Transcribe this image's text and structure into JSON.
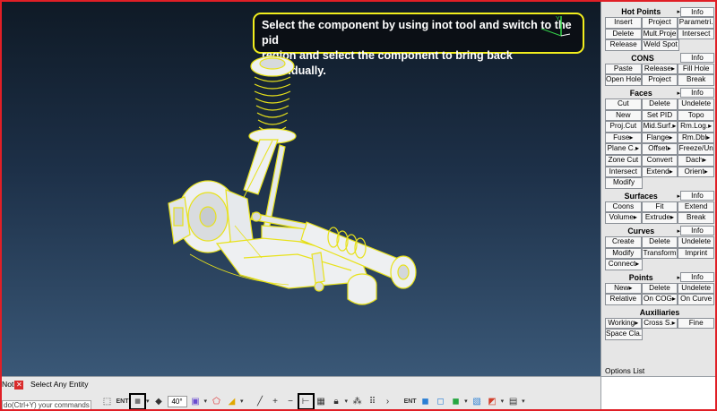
{
  "callout": {
    "line1": "Select the component by using inot tool and switch to the pid",
    "line2": "region and select the component to bring back individually."
  },
  "axis": {
    "y_label": "Y"
  },
  "panel": {
    "sections": [
      {
        "title": "Hot Points",
        "title_arrow": true,
        "info": "Info",
        "rows": [
          [
            "Insert",
            "Project",
            "Parametri."
          ],
          [
            "Delete",
            "Mult.Proje",
            "Intersect"
          ],
          [
            "Release",
            "Weld Spot",
            ""
          ]
        ]
      },
      {
        "title": "CONS",
        "title_arrow": false,
        "info": "Info",
        "rows": [
          [
            "Paste",
            "Release▸",
            "Fill Hole"
          ],
          [
            "Open Hole",
            "Project",
            "Break"
          ]
        ]
      },
      {
        "title": "Faces",
        "title_arrow": true,
        "info": "Info",
        "rows": [
          [
            "Cut",
            "Delete",
            "Undelete"
          ],
          [
            "New",
            "Set PID",
            "Topo"
          ],
          [
            "Proj.Cut",
            "Mid.Surf.▸",
            "Rm.Log.▸"
          ],
          [
            "Fuse▸",
            "Flange▸",
            "Rm.Dbl▸"
          ],
          [
            "Plane C.▸",
            "Offset▸",
            "Freeze/Un"
          ],
          [
            "Zone Cut",
            "Convert",
            "Dach▸"
          ],
          [
            "Intersect",
            "Extend▸",
            "Orient▸"
          ],
          [
            "Modify",
            "",
            ""
          ]
        ]
      },
      {
        "title": "Surfaces",
        "title_arrow": true,
        "info": "Info",
        "rows": [
          [
            "Coons",
            "Fit",
            "Extend"
          ],
          [
            "Volume▸",
            "Extrude▸",
            "Break"
          ]
        ]
      },
      {
        "title": "Curves",
        "title_arrow": true,
        "info": "Info",
        "rows": [
          [
            "Create",
            "Delete",
            "Undelete"
          ],
          [
            "Modify",
            "Transform",
            "Imprint"
          ],
          [
            "Connect▸",
            "",
            ""
          ]
        ]
      },
      {
        "title": "Points",
        "title_arrow": true,
        "info": "Info",
        "rows": [
          [
            "New▸",
            "Delete",
            "Undelete"
          ],
          [
            "Relative",
            "On COG▸",
            "On Curve"
          ]
        ]
      },
      {
        "title": "Auxiliaries",
        "title_arrow": false,
        "info": "",
        "rows": [
          [
            "Working▸",
            "Cross S.▸",
            "Fine"
          ],
          [
            "Space Cla.",
            "",
            ""
          ]
        ]
      }
    ]
  },
  "options": {
    "title": "Options List"
  },
  "status": {
    "not_label": "Not",
    "select_label": "Select Any Entity",
    "command_text": "do(Ctrl+Y) your commands",
    "zoom_value": "40°"
  },
  "icons": {
    "toolbar": [
      "box-select-icon",
      "entity-ent-icon",
      "pid-select-icon",
      "eraser-icon",
      "zoom-angle-icon",
      "frame-icon",
      "polygon-select-icon",
      "fill-select-icon",
      "line-icon",
      "plus-icon",
      "minus-icon",
      "pipe-select-icon",
      "grid-icon",
      "lock-icon",
      "network-icon",
      "nodes-icon",
      "chevron-right-icon",
      "ent-icon",
      "cube-shaded-icon",
      "cube-wire-icon",
      "cube-color-icon",
      "cube-grid-icon",
      "cube-multi-icon",
      "cube-stack-icon"
    ]
  },
  "colors": {
    "callout_border": "#f2ee1d",
    "frame": "#e01f26",
    "wireframe": "#e8e21a",
    "model_fill": "#e9ecef"
  }
}
